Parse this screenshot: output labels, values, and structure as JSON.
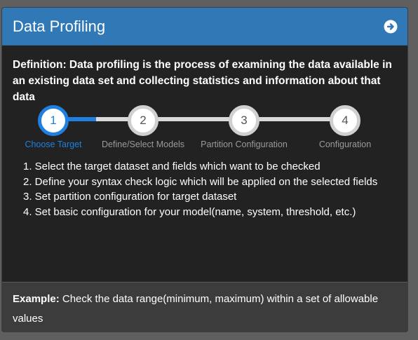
{
  "header": {
    "title": "Data Profiling",
    "next_icon": "arrow-circle-right-icon"
  },
  "definition": "Definition: Data profiling is the process of examining the data available in an existing data set and collecting statistics and information about that data",
  "steps": [
    {
      "number": "1",
      "label": "Choose Target",
      "active": true
    },
    {
      "number": "2",
      "label": "Define/Select Models",
      "active": false
    },
    {
      "number": "3",
      "label": "Partition Configuration",
      "active": false
    },
    {
      "number": "4",
      "label": "Configuration",
      "active": false
    }
  ],
  "instructions": [
    "1. Select the target dataset and fields which want to be checked",
    "2. Define your syntax check logic which will be applied on the selected fields",
    "3. Set partition configuration for target dataset",
    "4. Set basic configuration for your model(name, system, threshold, etc.)"
  ],
  "example": {
    "label": "Example:",
    "text": " Check the data range(minimum, maximum) within a set of allowable values"
  },
  "colors": {
    "header": "#3178b6",
    "accent": "#1f80e0",
    "panel": "#222222",
    "footer": "#3c3c3c"
  }
}
